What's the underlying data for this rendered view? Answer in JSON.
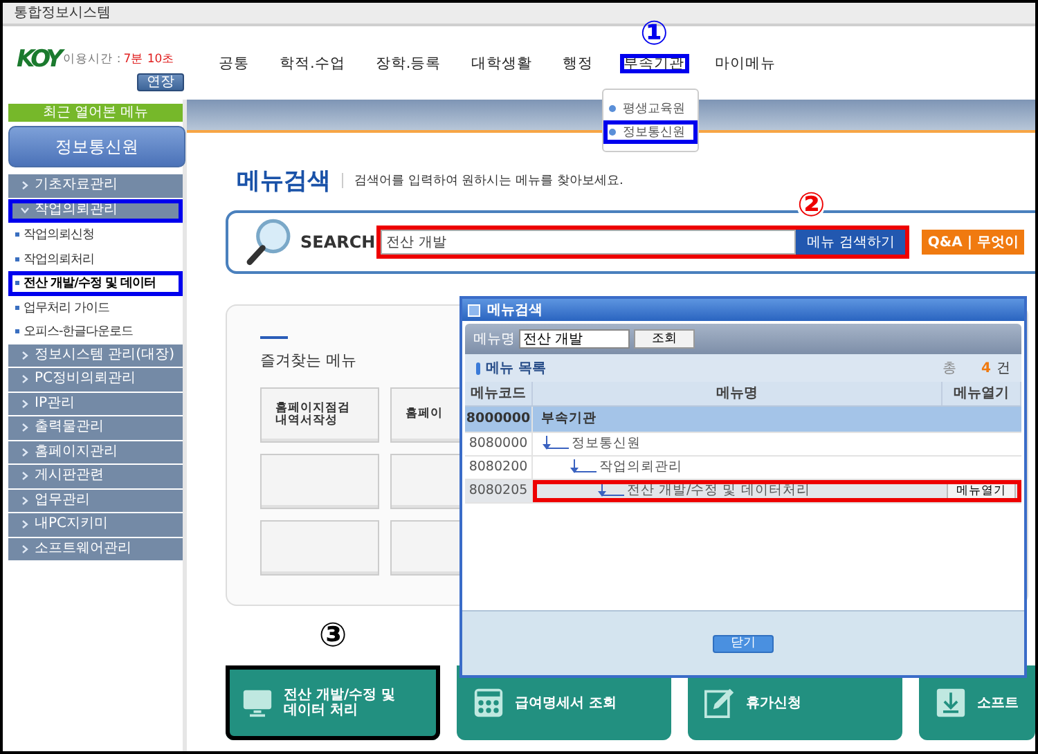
{
  "window": {
    "title": "통합정보시스템"
  },
  "header": {
    "logo": "KOY",
    "timer_label": "이용시간 :",
    "timer_value": "7분 10초",
    "extend_button": "연장",
    "nav": [
      {
        "label": "공통",
        "highlighted": false
      },
      {
        "label": "학적.수업",
        "highlighted": false
      },
      {
        "label": "장학.등록",
        "highlighted": false
      },
      {
        "label": "대학생활",
        "highlighted": false
      },
      {
        "label": "행정",
        "highlighted": false
      },
      {
        "label": "부속기관",
        "highlighted": true,
        "marker": "①"
      },
      {
        "label": "마이메뉴",
        "highlighted": false
      }
    ],
    "dropdown": [
      {
        "label": "평생교육원",
        "highlighted": false
      },
      {
        "label": "정보통신원",
        "highlighted": true
      }
    ]
  },
  "sidebar": {
    "recent_label": "최근 열어본 메뉴",
    "title_button": "정보통신원",
    "items": [
      {
        "label": "기초자료관리",
        "expanded": false,
        "highlighted": false
      },
      {
        "label": "작업의뢰관리",
        "expanded": true,
        "highlighted": true,
        "children": [
          {
            "label": "작업의뢰신청",
            "selected": false,
            "highlighted": false
          },
          {
            "label": "작업의뢰처리",
            "selected": false,
            "highlighted": false
          },
          {
            "label": "전산 개발/수정 및 데이터",
            "selected": true,
            "highlighted": true
          },
          {
            "label": "업무처리 가이드",
            "selected": false,
            "highlighted": false
          },
          {
            "label": "오피스-한글다운로드",
            "selected": false,
            "highlighted": false
          }
        ]
      },
      {
        "label": "정보시스템 관리(대장)",
        "expanded": false,
        "highlighted": false
      },
      {
        "label": "PC정비의뢰관리",
        "expanded": false,
        "highlighted": false
      },
      {
        "label": "IP관리",
        "expanded": false,
        "highlighted": false
      },
      {
        "label": "출력물관리",
        "expanded": false,
        "highlighted": false
      },
      {
        "label": "홈페이지관리",
        "expanded": false,
        "highlighted": false
      },
      {
        "label": "게시판관련",
        "expanded": false,
        "highlighted": false
      },
      {
        "label": "업무관리",
        "expanded": false,
        "highlighted": false
      },
      {
        "label": "내PC지키미",
        "expanded": false,
        "highlighted": false
      },
      {
        "label": "소프트웨어관리",
        "expanded": false,
        "highlighted": false
      }
    ]
  },
  "page": {
    "title": "메뉴검색",
    "subtitle": "검색어를 입력하여 원하시는 메뉴를 찾아보세요.",
    "search": {
      "label": "SEARCH",
      "value": "전산 개발",
      "button": "메뉴 검색하기",
      "highlighted": true,
      "marker": "②",
      "qa_button": "Q&A | 무엇이"
    },
    "favorites": {
      "title": "즐겨찾는 메뉴",
      "slots": [
        {
          "kind": "label",
          "lines": [
            "홈페이지점검",
            "내역서작성"
          ]
        },
        {
          "kind": "label",
          "lines": [
            "홈페이"
          ]
        },
        {
          "kind": "empty"
        },
        {
          "kind": "empty"
        },
        {
          "kind": "empty"
        },
        {
          "kind": "empty"
        }
      ]
    },
    "tiles": [
      {
        "label": "전산 개발/수정 및\n데이터 처리",
        "kind": "monitor",
        "highlighted": true,
        "marker": "③"
      },
      {
        "label": "급여명세서 조회",
        "kind": "calculator",
        "highlighted": false
      },
      {
        "label": "휴가신청",
        "kind": "pencil",
        "highlighted": false
      },
      {
        "label": "소프트",
        "kind": "download",
        "highlighted": false
      }
    ]
  },
  "popup": {
    "title": "메뉴검색",
    "field_label": "메뉴명",
    "field_value": "전산 개발",
    "search_button": "조회",
    "list_title": "메뉴 목록",
    "total_label": "총",
    "total_count": "4",
    "total_unit": "건",
    "columns": [
      "메뉴코드",
      "메뉴명",
      "메뉴열기"
    ],
    "rows": [
      {
        "code": "8000000",
        "name": "부속기관",
        "selected": false,
        "highlighted": false,
        "children": [
          {
            "code": "8080000",
            "name": "정보통신원",
            "selected": false,
            "highlighted": false,
            "children": [
              {
                "code": "8080200",
                "name": "작업의뢰관리",
                "selected": false,
                "highlighted": false,
                "children": [
                  {
                    "code": "8080205",
                    "name": "전산 개발/수정 및 데이터처리",
                    "selected": true,
                    "highlighted": true,
                    "open_button": "메뉴열기"
                  }
                ]
              }
            ]
          }
        ]
      }
    ],
    "close_button": "닫기"
  }
}
